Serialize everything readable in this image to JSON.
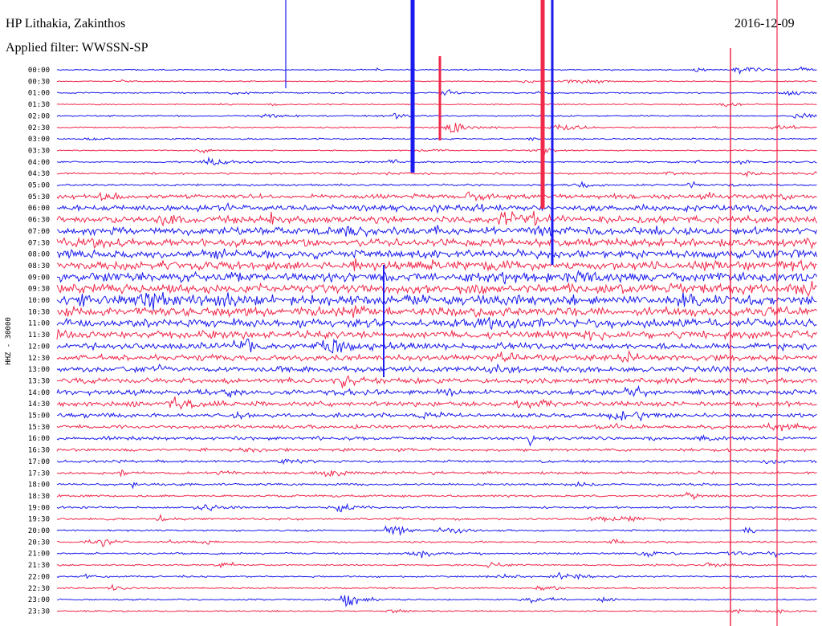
{
  "header": {
    "station": "HP Lithakia, Zakinthos",
    "filter": "Applied filter: WWSSN-SP",
    "date": "2016-12-09"
  },
  "colors": {
    "trace_a": "#1a1aee",
    "trace_b": "#f0284a",
    "background": "#ffffff",
    "text": "#000000"
  },
  "chart_data": {
    "type": "line",
    "title": "HP Lithakia, Zakinthos",
    "subtitle": "Applied filter: WWSSN-SP",
    "date": "2016-12-09",
    "ylabel": "HHZ - 30000",
    "xlabel": "",
    "y_tick_labels": [
      "00:00",
      "00:30",
      "01:00",
      "01:30",
      "02:00",
      "02:30",
      "03:00",
      "03:30",
      "04:00",
      "04:30",
      "05:00",
      "05:30",
      "06:00",
      "06:30",
      "07:00",
      "07:30",
      "08:00",
      "08:30",
      "09:00",
      "09:30",
      "10:00",
      "10:30",
      "11:00",
      "11:30",
      "12:00",
      "12:30",
      "13:00",
      "13:30",
      "14:00",
      "14:30",
      "15:00",
      "15:30",
      "16:00",
      "16:30",
      "17:00",
      "17:30",
      "18:00",
      "18:30",
      "19:00",
      "19:30",
      "20:00",
      "20:30",
      "21:00",
      "21:30",
      "22:00",
      "22:30",
      "23:00",
      "23:30"
    ],
    "trace_minutes": 30,
    "trace_colors_alternate": [
      "#1a1aee",
      "#f0284a"
    ],
    "noise_level_per_trace": [
      0.6,
      0.6,
      0.7,
      0.6,
      0.8,
      0.7,
      0.7,
      0.6,
      0.8,
      0.9,
      1.0,
      2.2,
      3.0,
      3.4,
      3.6,
      3.8,
      4.0,
      4.2,
      4.6,
      4.8,
      4.6,
      4.2,
      4.0,
      3.6,
      3.2,
      3.0,
      2.8,
      2.6,
      2.6,
      2.4,
      2.0,
      1.8,
      1.6,
      1.4,
      1.2,
      1.2,
      1.1,
      1.1,
      1.0,
      1.0,
      0.9,
      0.9,
      0.9,
      0.8,
      0.8,
      0.8,
      0.7,
      0.7
    ],
    "grid": false,
    "legend": "none"
  }
}
